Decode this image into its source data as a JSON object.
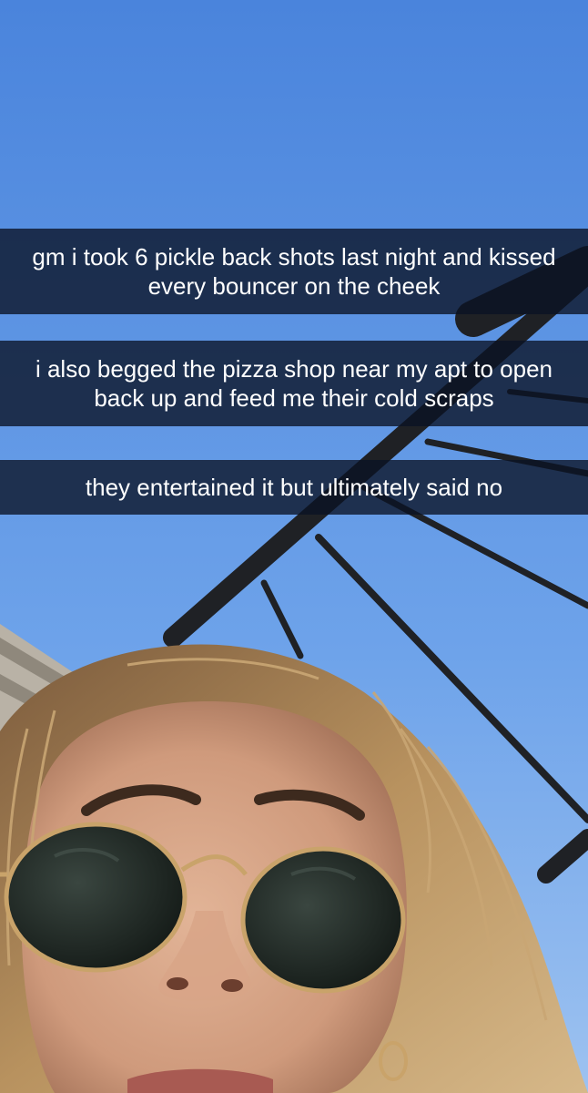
{
  "captions": [
    {
      "text": "gm i took 6 pickle back shots last night and kissed every bouncer on the cheek"
    },
    {
      "text": "i also begged the pizza shop near my apt to open back up and feed me their cold scraps"
    },
    {
      "text": "they entertained it but ultimately said no"
    }
  ],
  "colors": {
    "sky_top": "#4a84dc",
    "sky_bottom": "#8fb8ee",
    "caption_bg": "#0a1224",
    "caption_text": "#ffffff",
    "hair": "#b08a5e",
    "skin": "#d9a88a",
    "lens": "#1d2520",
    "frame": "#c9a36a"
  }
}
